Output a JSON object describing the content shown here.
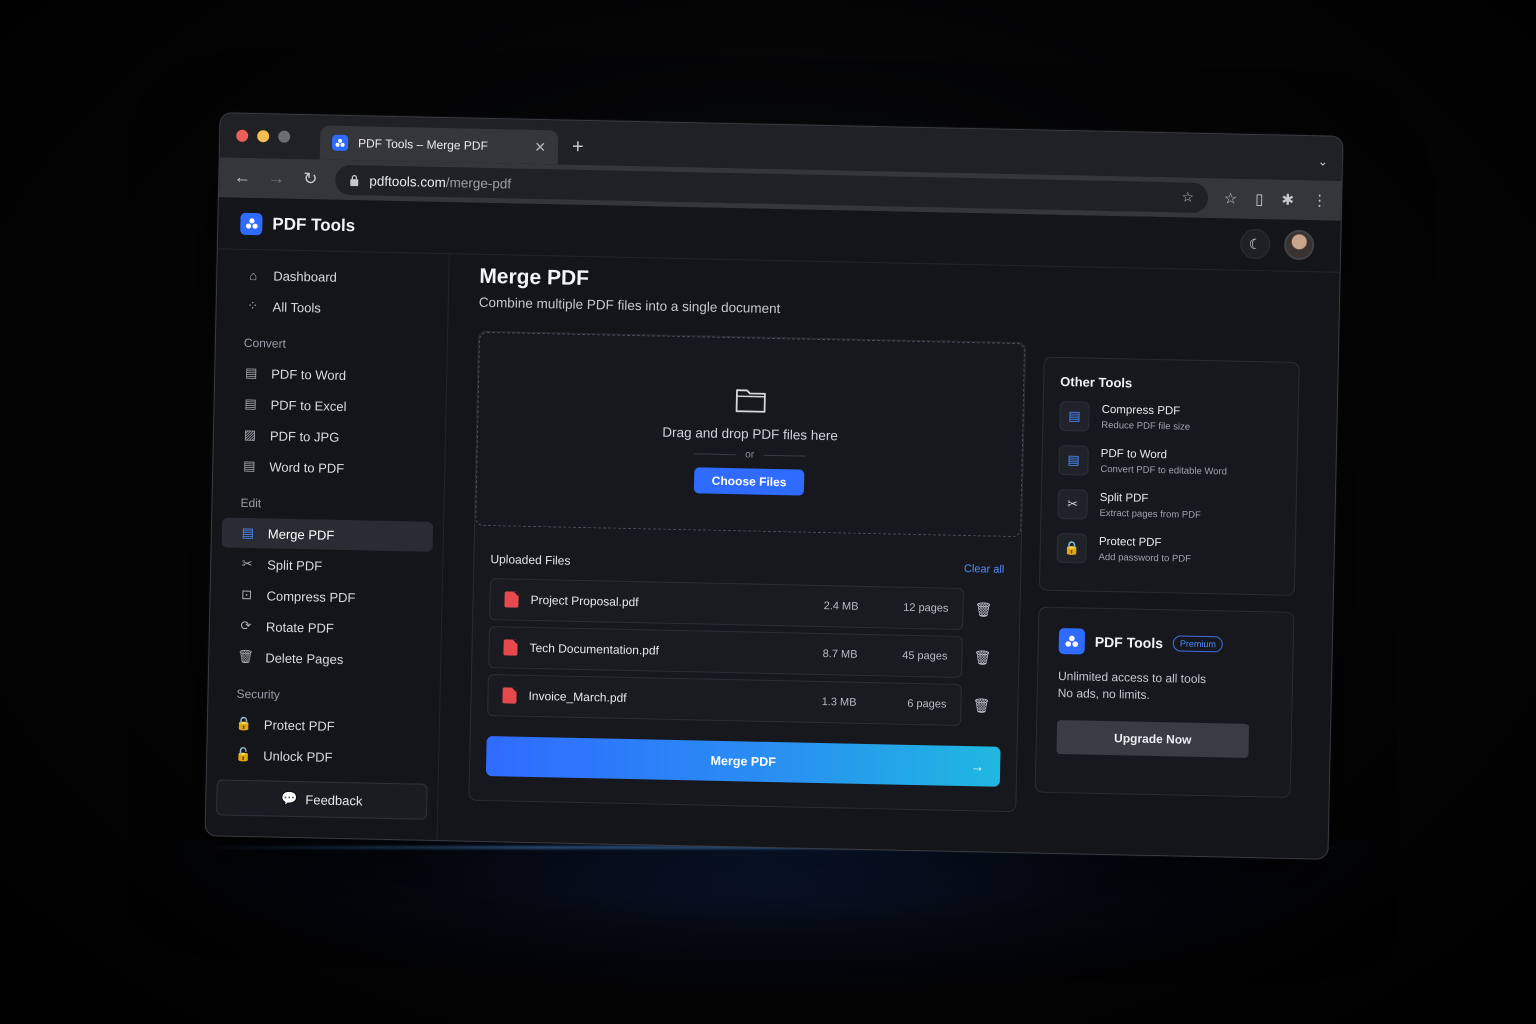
{
  "browser": {
    "tab_title": "PDF Tools – Merge PDF",
    "url_host": "pdftools.com",
    "url_path": "/merge-pdf"
  },
  "app": {
    "brand": "PDF Tools"
  },
  "sidebar": {
    "top": [
      {
        "label": "Dashboard",
        "icon": "home-icon"
      },
      {
        "label": "All Tools",
        "icon": "grid-icon"
      }
    ],
    "sections": [
      {
        "title": "Convert",
        "items": [
          {
            "label": "PDF to Word"
          },
          {
            "label": "PDF to Excel"
          },
          {
            "label": "PDF to JPG"
          },
          {
            "label": "Word to PDF"
          }
        ]
      },
      {
        "title": "Edit",
        "items": [
          {
            "label": "Merge PDF",
            "active": true
          },
          {
            "label": "Split PDF"
          },
          {
            "label": "Compress PDF"
          },
          {
            "label": "Rotate PDF"
          },
          {
            "label": "Delete Pages"
          }
        ]
      },
      {
        "title": "Security",
        "items": [
          {
            "label": "Protect PDF"
          },
          {
            "label": "Unlock PDF"
          }
        ]
      }
    ],
    "feedback_label": "Feedback"
  },
  "main": {
    "title": "Merge PDF",
    "subtitle": "Combine multiple PDF files into a single document",
    "dropzone": {
      "text": "Drag and drop PDF files here",
      "or": "or",
      "button": "Choose Files"
    },
    "uploaded": {
      "title": "Uploaded Files",
      "clear_all": "Clear all",
      "files": [
        {
          "name": "Project Proposal.pdf",
          "size": "2.4 MB",
          "pages": "12 pages"
        },
        {
          "name": "Tech Documentation.pdf",
          "size": "8.7 MB",
          "pages": "45 pages"
        },
        {
          "name": "Invoice_March.pdf",
          "size": "1.3 MB",
          "pages": "6 pages"
        }
      ]
    },
    "merge_button": "Merge PDF"
  },
  "other_tools": {
    "title": "Other Tools",
    "items": [
      {
        "name": "Compress PDF",
        "desc": "Reduce PDF file size"
      },
      {
        "name": "PDF to Word",
        "desc": "Convert PDF to editable Word"
      },
      {
        "name": "Split PDF",
        "desc": "Extract pages from PDF"
      },
      {
        "name": "Protect PDF",
        "desc": "Add password to PDF"
      }
    ]
  },
  "premium": {
    "brand": "PDF Tools",
    "badge": "Premium",
    "line1": "Unlimited access to all tools",
    "line2": "No ads, no limits.",
    "button": "Upgrade Now"
  },
  "colors": {
    "accent": "#2f6bff",
    "pdf_red": "#e5484d",
    "background": "#141519"
  }
}
